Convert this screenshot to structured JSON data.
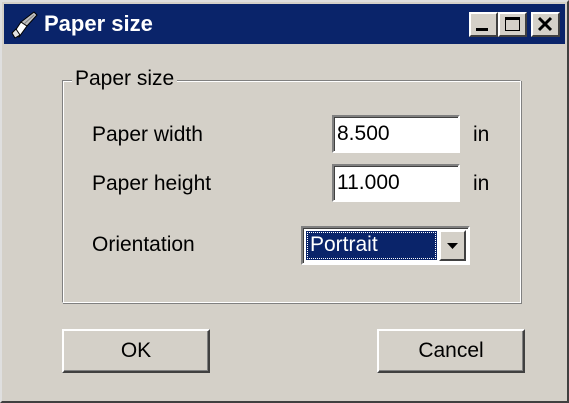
{
  "window": {
    "title": "Paper size",
    "title_bar_color": "#0a246a",
    "icon": "paper-brush-icon",
    "controls": [
      "minimize-icon",
      "maximize-icon",
      "close-icon"
    ]
  },
  "group": {
    "label": "Paper size"
  },
  "fields": {
    "width": {
      "label": "Paper width",
      "value": "8.500",
      "unit": "in"
    },
    "height": {
      "label": "Paper height",
      "value": "11.000",
      "unit": "in"
    }
  },
  "orientation": {
    "label": "Orientation",
    "selected": "Portrait"
  },
  "buttons": {
    "ok": "OK",
    "cancel": "Cancel"
  }
}
